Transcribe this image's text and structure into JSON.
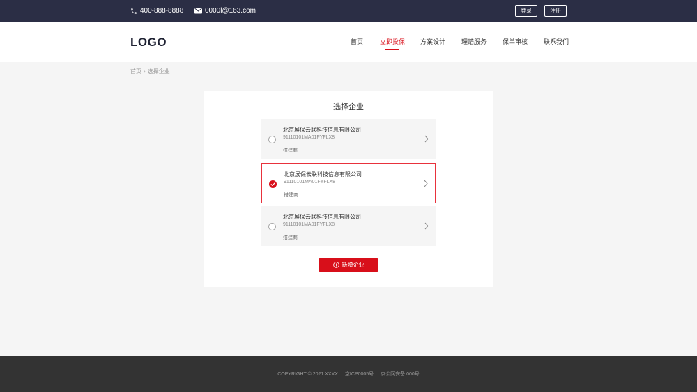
{
  "topbar": {
    "phone": "400-888-8888",
    "email": "0000l@163.com",
    "login_label": "登录",
    "register_label": "注册"
  },
  "header": {
    "logo": "LOGO",
    "nav": [
      "首页",
      "立即投保",
      "方案设计",
      "理赔服务",
      "保单审核",
      "联系我们"
    ],
    "active_nav": "立即投保"
  },
  "breadcrumb": {
    "home": "首页",
    "current": "选择企业"
  },
  "main": {
    "title": "选择企业",
    "companies": [
      {
        "name": "北京展保云联科技信息有限公司",
        "code": "91110101MA01FYFLX8",
        "role": "搭建商",
        "selected": false
      },
      {
        "name": "北京展保云联科技信息有限公司",
        "code": "91110101MA01FYFLX8",
        "role": "搭建商",
        "selected": true
      },
      {
        "name": "北京展保云联科技信息有限公司",
        "code": "91110101MA01FYFLX8",
        "role": "搭建商",
        "selected": false
      }
    ],
    "add_button_label": "新增企业"
  },
  "footer": {
    "copyright": "COPYRIGHT © 2021 XXXX",
    "icp": "京ICP0005号",
    "police": "京公网安备 000号"
  },
  "colors": {
    "accent": "#d80f1a",
    "topbar": "#2b2e45",
    "footer": "#333333"
  }
}
